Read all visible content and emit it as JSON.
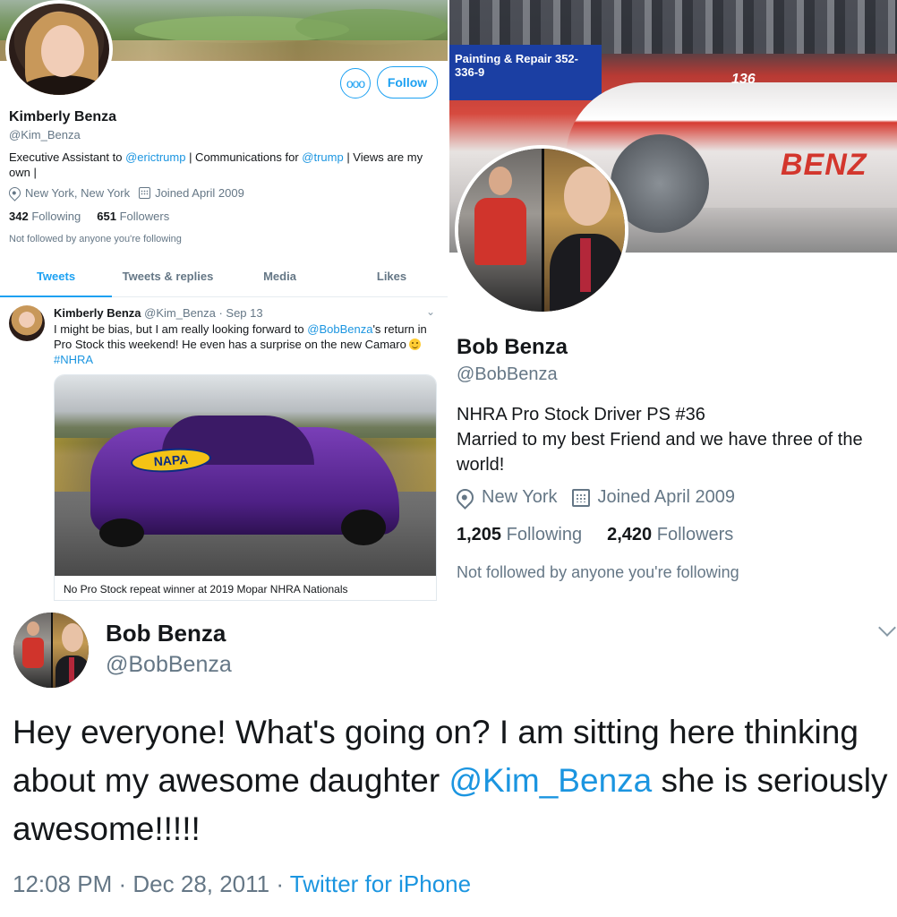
{
  "kim_profile": {
    "more_icon": "ooo",
    "follow_label": "Follow",
    "name": "Kimberly Benza",
    "handle": "@Kim_Benza",
    "bio": {
      "p1": "Executive Assistant to ",
      "m1": "@erictrump",
      "p2": " | Communications for ",
      "m2": "@trump",
      "p3": " | Views are my own |"
    },
    "location": "New York, New York",
    "joined": "Joined April 2009",
    "following_count": "342",
    "following_label": "Following",
    "followers_count": "651",
    "followers_label": "Followers",
    "not_followed": "Not followed by anyone you're following",
    "tabs": [
      {
        "label": "Tweets"
      },
      {
        "label": "Tweets & replies"
      },
      {
        "label": "Media"
      },
      {
        "label": "Likes"
      }
    ],
    "tweet": {
      "name": "Kimberly Benza",
      "handle_date": "@Kim_Benza · Sep 13",
      "text_p1": "I might be bias, but I am really looking forward to ",
      "text_m1": "@BobBenza",
      "text_p2": "'s return in Pro Stock this weekend! He even has a surprise on the new Camaro ",
      "hashtag": "#NHRA",
      "image_text": "NAPA",
      "caption": "No Pro Stock repeat winner at 2019 Mopar NHRA Nationals"
    }
  },
  "bob_profile": {
    "banner_sign": "Painting & Repair 352-336-9",
    "banner_number": "136",
    "banner_name": "BENZ",
    "name": "Bob Benza",
    "handle": "@BobBenza",
    "bio_line1": "NHRA Pro Stock Driver PS #36",
    "bio_line2": "Married to my best Friend and we have three of the world!",
    "location": "New York",
    "joined": "Joined April 2009",
    "following_count": "1,205",
    "following_label": "Following",
    "followers_count": "2,420",
    "followers_label": "Followers",
    "not_followed": "Not followed by anyone you're following"
  },
  "bob_tweet": {
    "name": "Bob Benza",
    "handle": "@BobBenza",
    "text_p1": "Hey everyone! What's going on? I am sitting here thinking about my awesome daughter ",
    "text_mention": "@Kim_Benza",
    "text_p2": " she is seriously awesome!!!!!",
    "time_date": "12:08 PM · Dec 28, 2011 · ",
    "source": "Twitter for iPhone"
  },
  "colors": {
    "link": "#1b95e0",
    "accent": "#1da1f2",
    "muted": "#657786",
    "text": "#14171a"
  },
  "icons": [
    "location-pin-icon",
    "calendar-icon",
    "more-options-icon",
    "chevron-down-icon",
    "smiley-emoji-icon"
  ]
}
